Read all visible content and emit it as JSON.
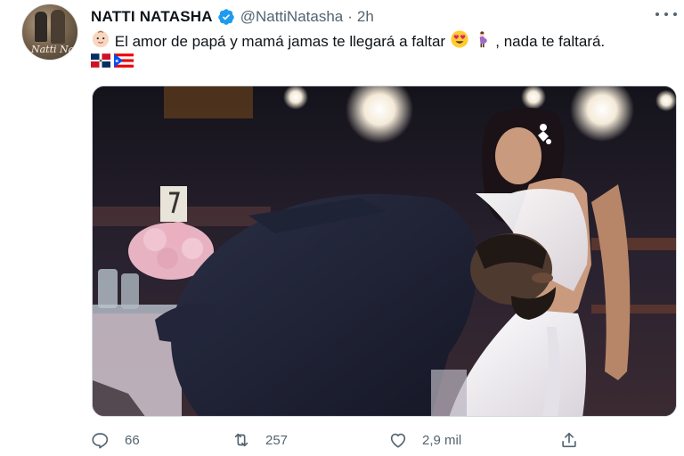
{
  "author": {
    "name": "NATTI NATASHA",
    "handle": "@NattiNatasha",
    "time": "2h",
    "separator": "·",
    "avatar_signature": "Natti  Nat"
  },
  "tweet": {
    "text_main": "El amor de papá y mamá jamas te llegará a faltar",
    "text_tail": ", nada te faltará.",
    "emojis": [
      "baby-face-emoji",
      "heart-eyes-emoji",
      "pregnant-woman-emoji"
    ],
    "flags": [
      "dominican-republic-flag",
      "puerto-rico-flag"
    ]
  },
  "actions": {
    "reply_count": "66",
    "retweet_count": "257",
    "like_count": "2,9 mil"
  },
  "colors": {
    "verified": "#1d9bf0",
    "secondary_text": "#536471",
    "primary_text": "#0f1419"
  }
}
